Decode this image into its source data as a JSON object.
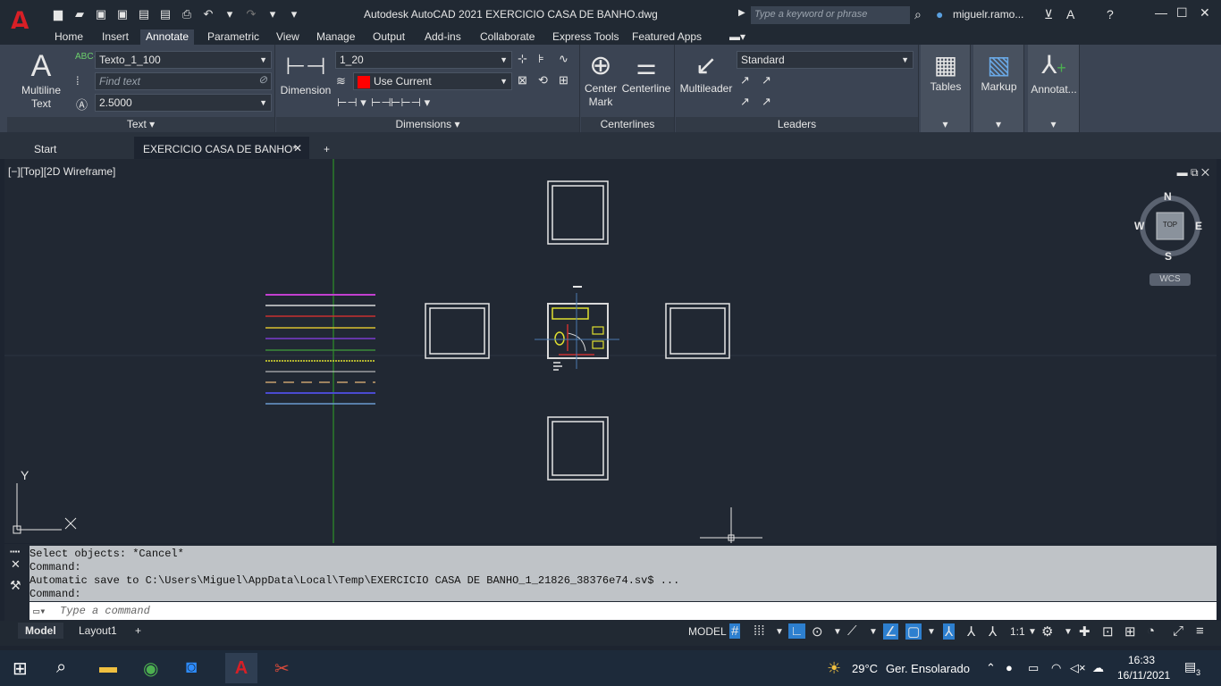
{
  "app": {
    "title": "Autodesk AutoCAD 2021    EXERCICIO CASA DE BANHO.dwg",
    "search_placeholder": "Type a keyword or phrase",
    "user": "miguelr.ramo..."
  },
  "ribbon_tabs": [
    "Home",
    "Insert",
    "Annotate",
    "Parametric",
    "View",
    "Manage",
    "Output",
    "Add-ins",
    "Collaborate",
    "Express Tools",
    "Featured Apps"
  ],
  "active_tab": "Annotate",
  "panels": {
    "text": {
      "title": "Text",
      "multiline_label_1": "Multiline",
      "multiline_label_2": "Text",
      "style": "Texto_1_100",
      "find_placeholder": "Find text",
      "height": "2.5000"
    },
    "dimensions": {
      "title": "Dimensions",
      "dimension_label": "Dimension",
      "style": "1_20",
      "layer": "Use Current"
    },
    "centerlines": {
      "title": "Centerlines",
      "center_mark_1": "Center",
      "center_mark_2": "Mark",
      "centerline": "Centerline"
    },
    "leaders": {
      "title": "Leaders",
      "multileader": "Multileader",
      "style": "Standard"
    },
    "tables": "Tables",
    "markup": "Markup",
    "annotate": "Annotat..."
  },
  "doc_tabs": {
    "start": "Start",
    "current": "EXERCICIO CASA DE BANHO*"
  },
  "viewport": {
    "label": "[−][Top][2D Wireframe]",
    "compass": {
      "n": "N",
      "s": "S",
      "e": "E",
      "w": "W",
      "top": "TOP",
      "wcs": "WCS"
    },
    "ucs_y": "Y"
  },
  "command": {
    "history": [
      "Select objects: *Cancel*",
      "Command:",
      "Automatic save to C:\\Users\\Miguel\\AppData\\Local\\Temp\\EXERCICIO CASA DE BANHO_1_21826_38376e74.sv$ ...",
      "Command:"
    ],
    "placeholder": "Type a command"
  },
  "layout_tabs": [
    "Model",
    "Layout1"
  ],
  "status": {
    "model": "MODEL",
    "scale": "1:1"
  },
  "taskbar": {
    "weather_temp": "29°C",
    "weather_text": "Ger. Ensolarado",
    "time": "16:33",
    "date": "16/11/2021",
    "notifications": "3"
  },
  "colors": {
    "accent_blue": "#2d7fcf",
    "brand_red": "#d81f26",
    "canvas_bg": "#212833"
  }
}
